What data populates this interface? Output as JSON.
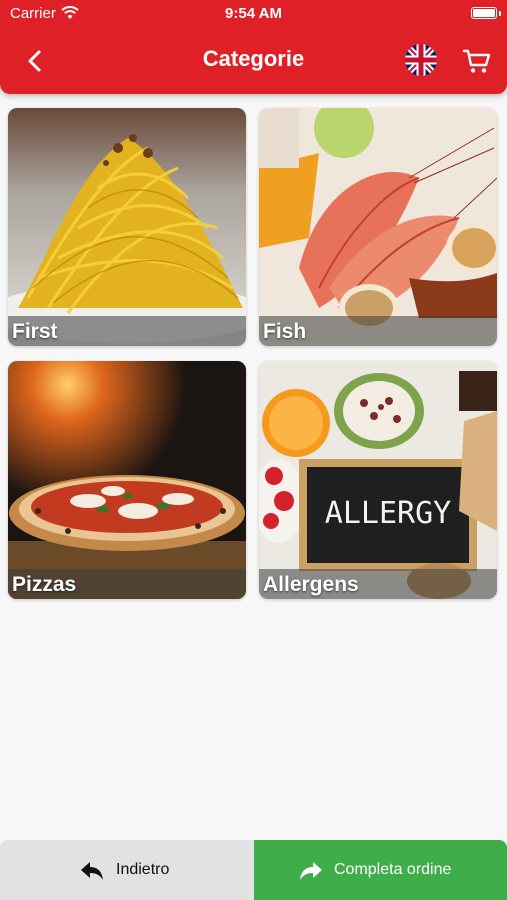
{
  "status_bar": {
    "carrier": "Carrier",
    "time": "9:54 AM"
  },
  "header": {
    "title": "Categorie",
    "back_icon": "chevron-left-icon",
    "language_icon": "uk-flag-icon",
    "cart_icon": "shopping-cart-icon",
    "color": "#e02027"
  },
  "categories": [
    {
      "label": "First",
      "image": "spaghetti-carbonara-photo"
    },
    {
      "label": "Fish",
      "image": "grilled-shrimp-scallops-photo"
    },
    {
      "label": "Pizzas",
      "image": "margherita-pizza-photo"
    },
    {
      "label": "Allergens",
      "image": "allergy-chalkboard-photo"
    }
  ],
  "footer": {
    "back_label": "Indietro",
    "complete_label": "Completa ordine",
    "back_icon": "reply-arrow-icon",
    "complete_icon": "forward-arrow-icon",
    "complete_color": "#3fae4a"
  }
}
